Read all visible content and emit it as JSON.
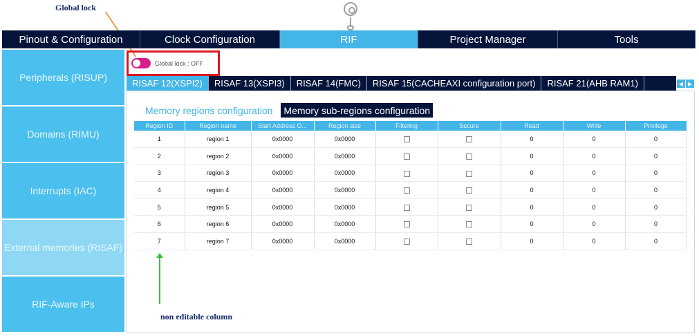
{
  "annotations": {
    "global_lock": "Global lock",
    "non_editable": "non editable column"
  },
  "top_tabs": [
    {
      "label": "Pinout & Configuration"
    },
    {
      "label": "Clock Configuration"
    },
    {
      "label": "RIF"
    },
    {
      "label": "Project Manager"
    },
    {
      "label": "Tools"
    }
  ],
  "sidebar": {
    "items": [
      {
        "label": "Peripherals (RISUP)"
      },
      {
        "label": "Domains (RIMU)"
      },
      {
        "label": "Interrupts (IAC)"
      },
      {
        "label": "External memories (RISAF)"
      },
      {
        "label": "RIF-Aware IPs"
      }
    ]
  },
  "global_lock": {
    "label": "Global lock : OFF"
  },
  "risaf_tabs": [
    {
      "label": "RISAF 12(XSPI2)"
    },
    {
      "label": "RISAF 13(XSPI3)"
    },
    {
      "label": "RISAF 14(FMC)"
    },
    {
      "label": "RISAF 15(CACHEAXI configuration port)"
    },
    {
      "label": "RISAF 21(AHB RAM1)"
    }
  ],
  "sub_tabs": [
    {
      "label": "Memory regions configuration"
    },
    {
      "label": "Memory sub-regions configuration"
    }
  ],
  "table": {
    "headers": [
      "Region ID",
      "Region name",
      "Start Address O...",
      "Region size",
      "Filtering",
      "Secure",
      "Read",
      "Write",
      "Privilege"
    ],
    "rows": [
      {
        "id": "1",
        "name": "region 1",
        "start": "0x0000",
        "size": "0x0000",
        "read": "0",
        "write": "0",
        "priv": "0"
      },
      {
        "id": "2",
        "name": "region 2",
        "start": "0x0000",
        "size": "0x0000",
        "read": "0",
        "write": "0",
        "priv": "0"
      },
      {
        "id": "3",
        "name": "region 3",
        "start": "0x0000",
        "size": "0x0000",
        "read": "0",
        "write": "0",
        "priv": "0"
      },
      {
        "id": "4",
        "name": "region 4",
        "start": "0x0000",
        "size": "0x0000",
        "read": "0",
        "write": "0",
        "priv": "0"
      },
      {
        "id": "5",
        "name": "region 5",
        "start": "0x0000",
        "size": "0x0000",
        "read": "0",
        "write": "0",
        "priv": "0"
      },
      {
        "id": "6",
        "name": "region 6",
        "start": "0x0000",
        "size": "0x0000",
        "read": "0",
        "write": "0",
        "priv": "0"
      },
      {
        "id": "7",
        "name": "region 7",
        "start": "0x0000",
        "size": "0x0000",
        "read": "0",
        "write": "0",
        "priv": "0"
      }
    ]
  },
  "colors": {
    "accent": "#43b5e6",
    "dark_tab": "#04143a",
    "highlight_box": "#d8191f",
    "toggle": "#d91e8c",
    "arrow_green": "#3ec23e"
  }
}
